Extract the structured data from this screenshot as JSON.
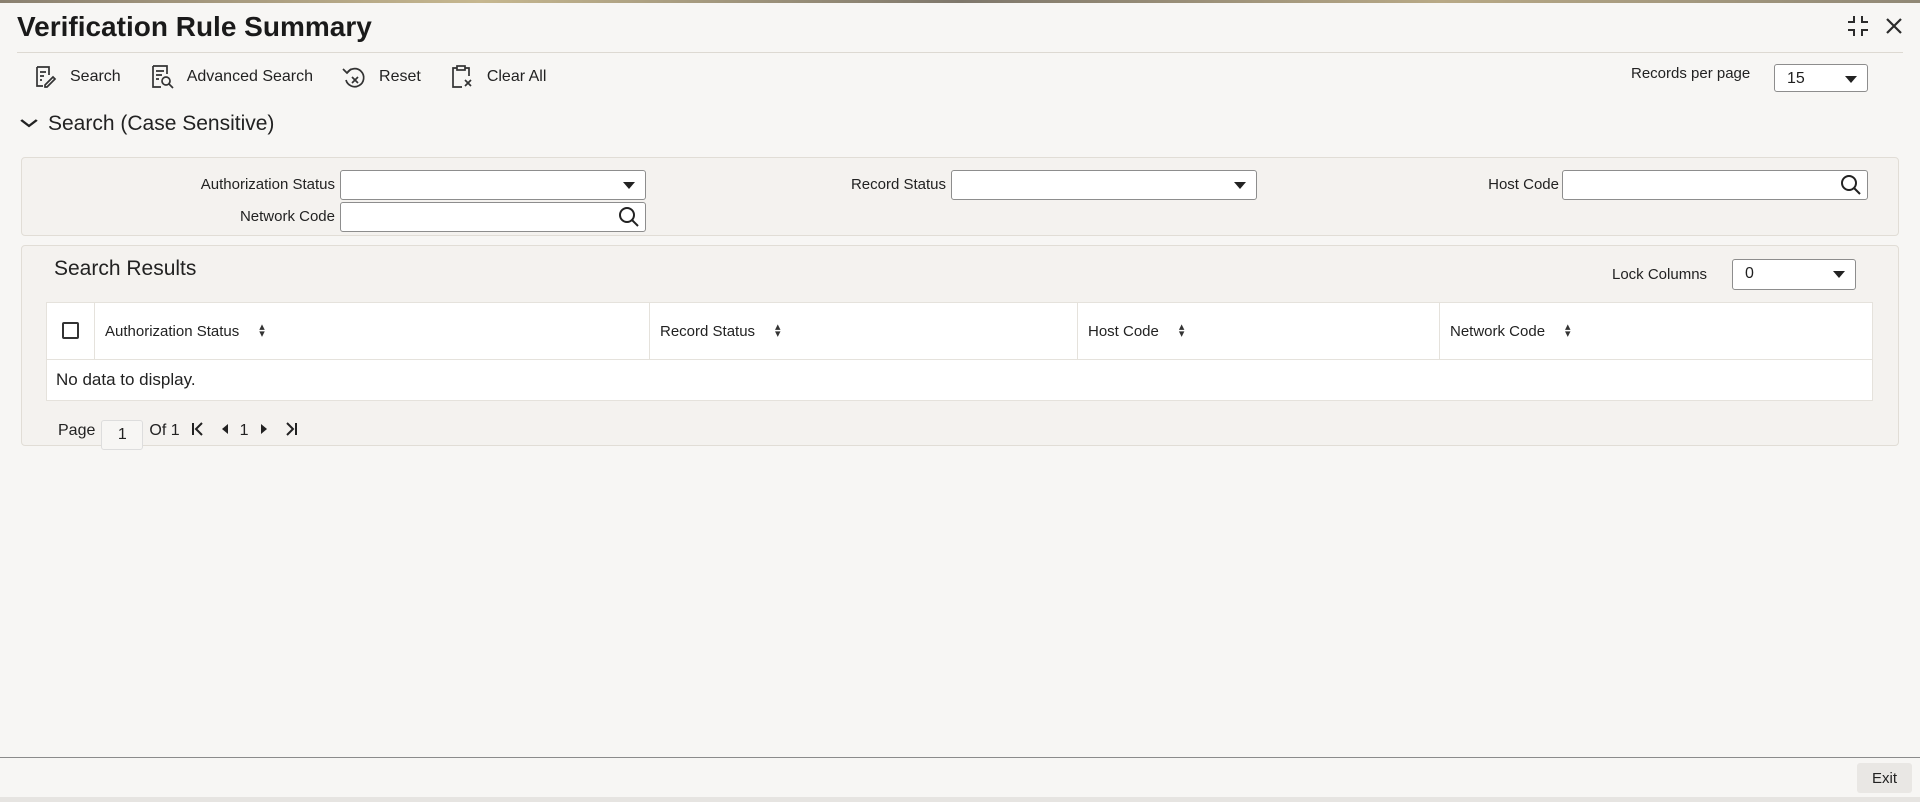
{
  "window": {
    "title": "Verification Rule Summary",
    "icons": [
      "maximize-icon",
      "close-icon"
    ]
  },
  "toolbar": {
    "search": "Search",
    "advanced_search": "Advanced Search",
    "reset": "Reset",
    "clear_all": "Clear All"
  },
  "records_per_page": {
    "label": "Records per page",
    "value": "15"
  },
  "search_section": {
    "title": "Search (Case Sensitive)",
    "fields": {
      "authorization_status": {
        "label": "Authorization Status",
        "value": ""
      },
      "record_status": {
        "label": "Record Status",
        "value": ""
      },
      "host_code": {
        "label": "Host Code",
        "value": ""
      },
      "network_code": {
        "label": "Network Code",
        "value": ""
      }
    }
  },
  "results": {
    "title": "Search Results",
    "lock_columns": {
      "label": "Lock Columns",
      "value": "0"
    },
    "columns": [
      "Authorization Status",
      "Record Status",
      "Host Code",
      "Network Code"
    ],
    "empty_message": "No data to display."
  },
  "pagination": {
    "page_label": "Page",
    "current": "1",
    "of_label": "Of 1",
    "page_number": "1"
  },
  "footer": {
    "exit": "Exit"
  }
}
